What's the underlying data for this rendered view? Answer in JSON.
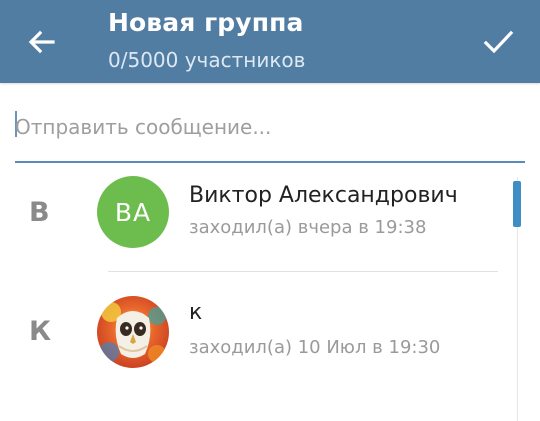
{
  "header": {
    "title": "Новая группа",
    "subtitle": "0/5000 участников",
    "back_icon": "arrow-back-icon",
    "confirm_icon": "checkmark-icon",
    "colors": {
      "background": "#527da3",
      "text": "#ffffff"
    }
  },
  "search": {
    "placeholder": "Отправить сообщение...",
    "value": ""
  },
  "contacts": [
    {
      "section_letter": "В",
      "avatar_initials": "ВА",
      "avatar_color": "#6dbd4e",
      "name": "Виктор Александрович",
      "status": "заходил(а) вчера в 19:38"
    },
    {
      "section_letter": "К",
      "avatar_initials": "",
      "avatar_image": "owl-painting",
      "name": "к",
      "status": "заходил(а) 10 Июл в 19:30"
    }
  ],
  "scrollbar_color": "#3f8dc5"
}
